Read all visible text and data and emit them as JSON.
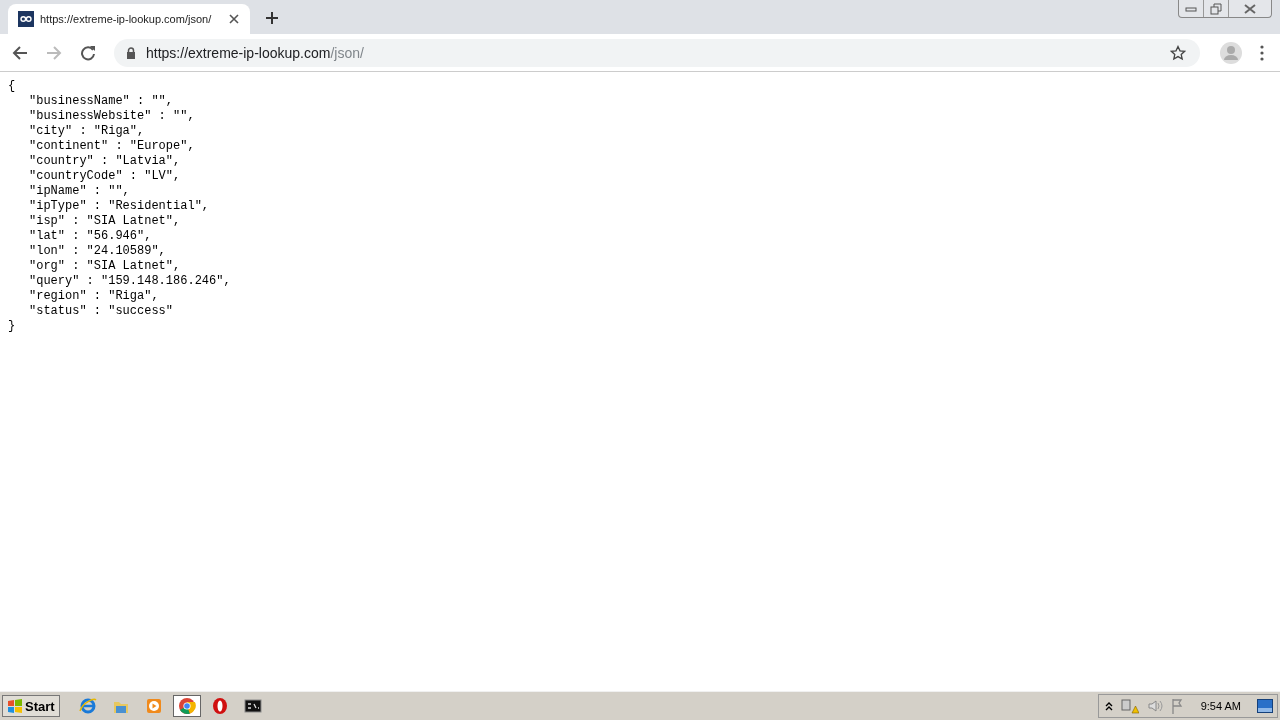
{
  "browser": {
    "tab": {
      "title": "https://extreme-ip-lookup.com/json/",
      "selected": true
    },
    "address": {
      "host": "https://extreme-ip-lookup.com",
      "path": "/json/"
    }
  },
  "document": {
    "open": "{",
    "close": "}",
    "fields": [
      "\"businessName\" : \"\",",
      "\"businessWebsite\" : \"\",",
      "\"city\" : \"Riga\",",
      "\"continent\" : \"Europe\",",
      "\"country\" : \"Latvia\",",
      "\"countryCode\" : \"LV\",",
      "\"ipName\" : \"\",",
      "\"ipType\" : \"Residential\",",
      "\"isp\" : \"SIA Latnet\",",
      "\"lat\" : \"56.946\",",
      "\"lon\" : \"24.10589\",",
      "\"org\" : \"SIA Latnet\",",
      "\"query\" : \"159.148.186.246\",",
      "\"region\" : \"Riga\",",
      "\"status\" : \"success\""
    ]
  },
  "taskbar": {
    "start": "Start",
    "apps": [
      {
        "kind": "ie",
        "selected": false
      },
      {
        "kind": "folder",
        "selected": false
      },
      {
        "kind": "media",
        "selected": false
      },
      {
        "kind": "chrome",
        "selected": true
      },
      {
        "kind": "opera",
        "selected": false
      },
      {
        "kind": "cmd",
        "selected": false
      }
    ],
    "clock": "9:54 AM"
  }
}
